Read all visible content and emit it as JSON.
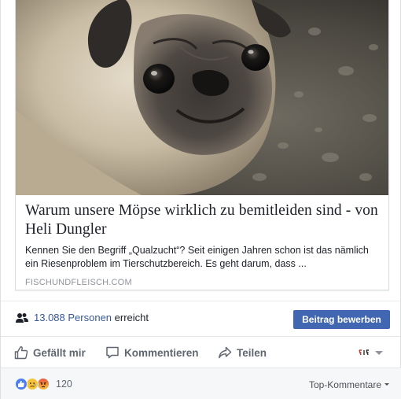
{
  "post": {
    "link_preview": {
      "image_alt": "pug",
      "title": "Warum unsere Möpse wirklich zu bemitleiden sind - von Heli Dungler",
      "description": "Kennen Sie den Begriff „Qualzucht“? Seit einigen Jahren schon ist das nämlich ein Riesenproblem im Tierschutzbereich. Es geht darum, dass ...",
      "domain": "FISCHUNDFLEISCH.COM"
    },
    "reach": {
      "count": "13.088",
      "people_label": "Personen",
      "reached_label": "erreicht",
      "boost_label": "Beitrag bewerben"
    },
    "actions": {
      "like_label": "Gefällt mir",
      "comment_label": "Kommentieren",
      "share_label": "Teilen"
    },
    "reactions": {
      "count": "120",
      "types": [
        "like",
        "sad",
        "angry"
      ],
      "sort_label": "Top-Kommentare"
    }
  },
  "colors": {
    "link_blue": "#365899",
    "button_blue": "#4267b2",
    "muted_gray": "#606770",
    "domain_gray": "#90949c"
  }
}
